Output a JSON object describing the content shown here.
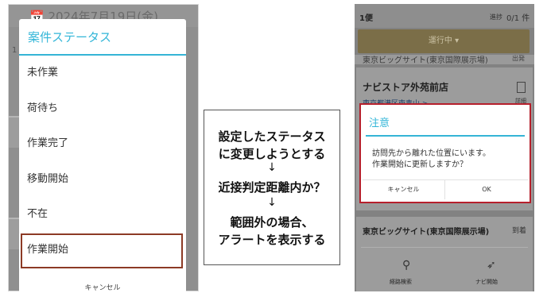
{
  "left": {
    "header_date": "📅 2024年7月19日(金)",
    "header_row": "1",
    "dialog_title": "案件ステータス",
    "items": [
      {
        "label": "未作業"
      },
      {
        "label": "荷待ち"
      },
      {
        "label": "作業完了"
      },
      {
        "label": "移動開始"
      },
      {
        "label": "不在"
      },
      {
        "label": "作業開始"
      }
    ],
    "selected_index": 5,
    "cancel_label": "キャンセル"
  },
  "flow": {
    "line1": "設定したステータス",
    "line2": "に変更しようとする",
    "arrow1": "↓",
    "line3": "近接判定距離内か？",
    "arrow2": "↓",
    "line4": "範囲外の場合、",
    "line5": "アラートを表示する"
  },
  "right": {
    "bin_label": "1便",
    "progress_label": "進捗",
    "progress_value": "0/1 件",
    "run_status": "運行中 ▾",
    "card1_title": "東京ビッグサイト(東京国際展示場)",
    "card1_status": "出発",
    "card2_name": "ナビストア外苑前店",
    "card2_address": "東京都港区南青山 >",
    "card2_detail": "詳細",
    "card3_name": "東京ビッグサイト(東京国際展示場)",
    "card3_status": "到着",
    "route_label": "経路検索",
    "navi_label": "ナビ開始",
    "dialog": {
      "title": "注意",
      "message_line1": "訪問先から離れた位置にいます。",
      "message_line2": "作業開始に更新しますか？",
      "cancel": "キャンセル",
      "ok": "OK"
    }
  },
  "colors": {
    "accent": "#33b6d8",
    "selected_border": "#8c3a25",
    "alert_border": "#b6202c"
  }
}
